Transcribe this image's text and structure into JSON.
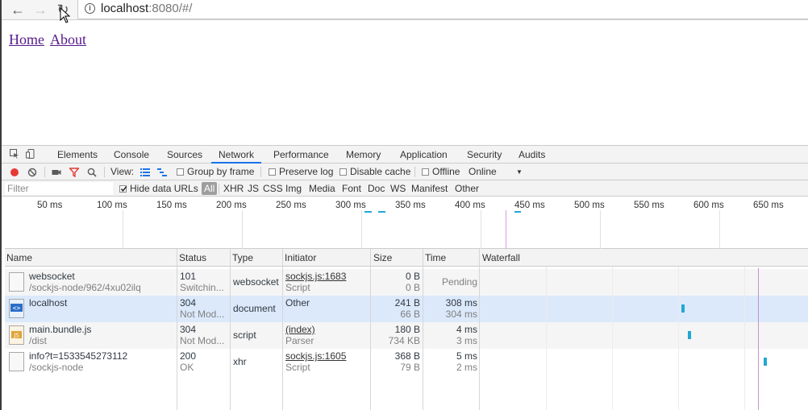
{
  "browser": {
    "url_host": "localhost",
    "url_rest": ":8080/#/"
  },
  "page": {
    "links": [
      "Home",
      "About"
    ]
  },
  "devtools": {
    "tabs": [
      "Elements",
      "Console",
      "Sources",
      "Network",
      "Performance",
      "Memory",
      "Application",
      "Security",
      "Audits"
    ],
    "active_tab": "Network",
    "toolbar": {
      "view_label": "View:",
      "group_by_frame": "Group by frame",
      "preserve_log": "Preserve log",
      "disable_cache": "Disable cache",
      "offline": "Offline",
      "throttle": "Online"
    },
    "filter": {
      "placeholder": "Filter",
      "hide_data_urls": "Hide data URLs",
      "types": [
        "All",
        "XHR",
        "JS",
        "CSS",
        "Img",
        "Media",
        "Font",
        "Doc",
        "WS",
        "Manifest",
        "Other"
      ],
      "active_type": "All"
    },
    "overview_ticks": [
      "50 ms",
      "100 ms",
      "150 ms",
      "200 ms",
      "250 ms",
      "300 ms",
      "350 ms",
      "400 ms",
      "450 ms",
      "500 ms",
      "550 ms",
      "600 ms",
      "650 ms"
    ],
    "columns": [
      "Name",
      "Status",
      "Type",
      "Initiator",
      "Size",
      "Time",
      "Waterfall"
    ],
    "requests": [
      {
        "name": "websocket",
        "path": "/sockjs-node/962/4xu02ilq",
        "status": "101",
        "status_text": "Switchin...",
        "type": "websocket",
        "initiator": "sockjs.js:1683",
        "initiator_sub": "Script",
        "initiator_link": true,
        "size": "0 B",
        "size_sub": "0 B",
        "time": "Pending",
        "time_sub": "",
        "icon": "file-icon",
        "wf_start": null
      },
      {
        "name": "localhost",
        "path": "",
        "status": "304",
        "status_text": "Not Mod...",
        "type": "document",
        "initiator": "Other",
        "initiator_sub": "",
        "initiator_link": false,
        "size": "241 B",
        "size_sub": "66 B",
        "time": "308 ms",
        "time_sub": "304 ms",
        "icon": "html-file-icon",
        "wf_start": 0.61
      },
      {
        "name": "main.bundle.js",
        "path": "/dist",
        "status": "304",
        "status_text": "Not Mod...",
        "type": "script",
        "initiator": "(index)",
        "initiator_sub": "Parser",
        "initiator_link": true,
        "size": "180 B",
        "size_sub": "734 KB",
        "time": "4 ms",
        "time_sub": "3 ms",
        "icon": "js-file-icon",
        "wf_start": 0.63
      },
      {
        "name": "info?t=1533545273112",
        "path": "/sockjs-node",
        "status": "200",
        "status_text": "OK",
        "type": "xhr",
        "initiator": "sockjs.js:1605",
        "initiator_sub": "Script",
        "initiator_link": true,
        "size": "368 B",
        "size_sub": "79 B",
        "time": "5 ms",
        "time_sub": "2 ms",
        "icon": "file-icon",
        "wf_start": 0.86
      }
    ]
  }
}
